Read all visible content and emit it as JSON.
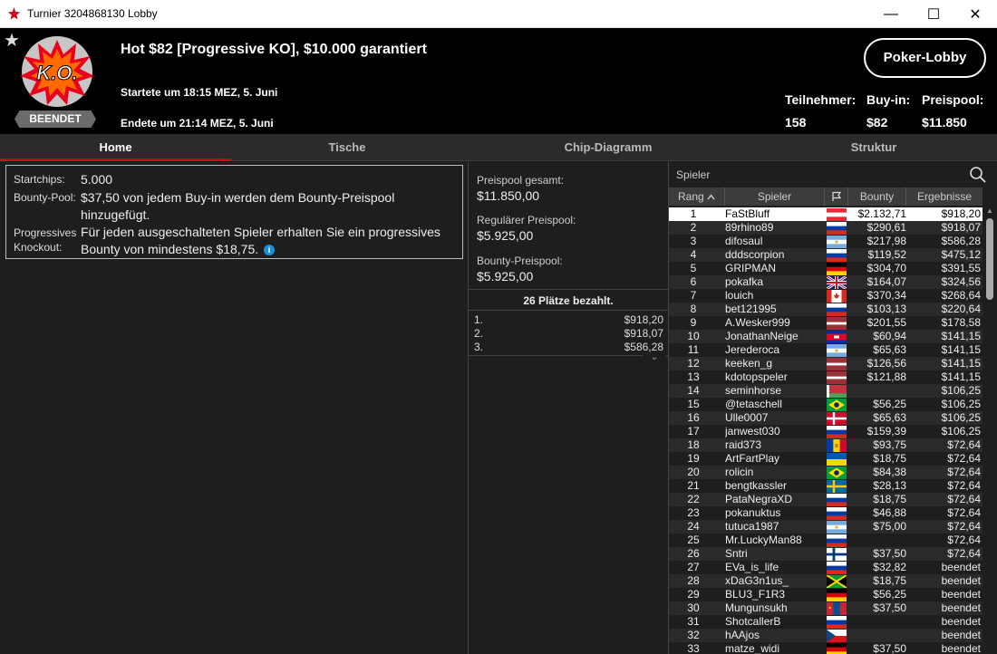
{
  "window": {
    "title": "Turnier 3204868130 Lobby",
    "minimize": "—",
    "maximize": "☐",
    "close": "✕"
  },
  "header": {
    "star": "★",
    "ko_text": "K.O.",
    "badge": "BEENDET",
    "title": "Hot $82 [Progressive KO], $10.000 garantiert",
    "started": "Startete um 18:15 MEZ, 5. Juni",
    "ended": "Endete um 21:14 MEZ, 5. Juni",
    "lobby_button": "Poker-Lobby",
    "stats": {
      "participants_label": "Teilnehmer:",
      "participants": "158",
      "buyin_label": "Buy-in:",
      "buyin": "$82",
      "prizepool_label": "Preispool:",
      "prizepool": "$11.850"
    }
  },
  "tabs": [
    "Home",
    "Tische",
    "Chip-Diagramm",
    "Struktur"
  ],
  "info": {
    "startchips_label": "Startchips:",
    "startchips": "5.000",
    "bounty_label": "Bounty-Pool:",
    "bounty_line1": "$37,50 von jedem Buy-in werden dem Bounty-Preispool",
    "bounty_line2": "hinzugefügt.",
    "pko_label1": "Progressives",
    "pko_label2": "Knockout:",
    "pko_line1": "Für jeden ausgeschalteten Spieler erhalten Sie ein progressives",
    "pko_line2": "Bounty von mindestens $18,75.",
    "info_icon": "i"
  },
  "prizes": {
    "total_label": "Preispool gesamt:",
    "total": "$11.850,00",
    "regular_label": "Regulärer Preispool:",
    "regular": "$5.925,00",
    "bounty_label": "Bounty-Preispool:",
    "bounty": "$5.925,00",
    "paid_header": "26 Plätze bezahlt.",
    "places": [
      {
        "place": "1.",
        "amount": "$918,20"
      },
      {
        "place": "2.",
        "amount": "$918,07"
      },
      {
        "place": "3.",
        "amount": "$586,28"
      }
    ],
    "more_icon": "⌄"
  },
  "players": {
    "search_label": "Spieler",
    "columns": {
      "rank": "Rang",
      "player": "Spieler",
      "bounty": "Bounty",
      "result": "Ergebnisse"
    },
    "rows": [
      {
        "rank": "1",
        "name": "FaStBluff",
        "flag": "AT",
        "bounty": "$2.132,71",
        "result": "$918,20"
      },
      {
        "rank": "2",
        "name": "89rhino89",
        "flag": "RU",
        "bounty": "$290,61",
        "result": "$918,07"
      },
      {
        "rank": "3",
        "name": "difosaul",
        "flag": "AR",
        "bounty": "$217,98",
        "result": "$586,28"
      },
      {
        "rank": "4",
        "name": "dddscorpion",
        "flag": "RU",
        "bounty": "$119,52",
        "result": "$475,12"
      },
      {
        "rank": "5",
        "name": "GRIPMAN",
        "flag": "DE",
        "bounty": "$304,70",
        "result": "$391,55"
      },
      {
        "rank": "6",
        "name": "pokafka",
        "flag": "GB",
        "bounty": "$164,07",
        "result": "$324,56"
      },
      {
        "rank": "7",
        "name": "louich",
        "flag": "CA",
        "bounty": "$370,34",
        "result": "$268,64"
      },
      {
        "rank": "8",
        "name": "bet121995",
        "flag": "RU",
        "bounty": "$103,13",
        "result": "$220,64"
      },
      {
        "rank": "9",
        "name": "A.Wesker999",
        "flag": "LV",
        "bounty": "$201,55",
        "result": "$178,58"
      },
      {
        "rank": "10",
        "name": "JonathanNeige",
        "flag": "KH",
        "bounty": "$60,94",
        "result": "$141,15"
      },
      {
        "rank": "11",
        "name": "Jerederoca",
        "flag": "AR",
        "bounty": "$65,63",
        "result": "$141,15"
      },
      {
        "rank": "12",
        "name": "keeken_g",
        "flag": "LV",
        "bounty": "$126,56",
        "result": "$141,15"
      },
      {
        "rank": "13",
        "name": "kdotopspeler",
        "flag": "LV",
        "bounty": "$121,88",
        "result": "$141,15"
      },
      {
        "rank": "14",
        "name": "seminhorse",
        "flag": "BY",
        "bounty": "",
        "result": "$106,25"
      },
      {
        "rank": "15",
        "name": "@tetaschell",
        "flag": "BR",
        "bounty": "$56,25",
        "result": "$106,25"
      },
      {
        "rank": "16",
        "name": "Ulle0007",
        "flag": "DK",
        "bounty": "$65,63",
        "result": "$106,25"
      },
      {
        "rank": "17",
        "name": "janwest030",
        "flag": "RU",
        "bounty": "$159,39",
        "result": "$106,25"
      },
      {
        "rank": "18",
        "name": "raid373",
        "flag": "MD",
        "bounty": "$93,75",
        "result": "$72,64"
      },
      {
        "rank": "19",
        "name": "ArtFartPlay",
        "flag": "UA",
        "bounty": "$18,75",
        "result": "$72,64"
      },
      {
        "rank": "20",
        "name": "rolicin",
        "flag": "BR",
        "bounty": "$84,38",
        "result": "$72,64"
      },
      {
        "rank": "21",
        "name": "bengtkassler",
        "flag": "SE",
        "bounty": "$28,13",
        "result": "$72,64"
      },
      {
        "rank": "22",
        "name": "PataNegraXD",
        "flag": "RU",
        "bounty": "$18,75",
        "result": "$72,64"
      },
      {
        "rank": "23",
        "name": "pokanuktus",
        "flag": "RU",
        "bounty": "$46,88",
        "result": "$72,64"
      },
      {
        "rank": "24",
        "name": "tutuca1987",
        "flag": "AR",
        "bounty": "$75,00",
        "result": "$72,64"
      },
      {
        "rank": "25",
        "name": "Mr.LuckyMan88",
        "flag": "RU",
        "bounty": "",
        "result": "$72,64"
      },
      {
        "rank": "26",
        "name": "Sntri",
        "flag": "FI",
        "bounty": "$37,50",
        "result": "$72,64"
      },
      {
        "rank": "27",
        "name": "EVa_is_life",
        "flag": "RU",
        "bounty": "$32,82",
        "result": "beendet"
      },
      {
        "rank": "28",
        "name": "xDaG3n1us_",
        "flag": "JM",
        "bounty": "$18,75",
        "result": "beendet"
      },
      {
        "rank": "29",
        "name": "BLU3_F1R3",
        "flag": "DE",
        "bounty": "$56,25",
        "result": "beendet"
      },
      {
        "rank": "30",
        "name": "Mungunsukh",
        "flag": "MN",
        "bounty": "$37,50",
        "result": "beendet"
      },
      {
        "rank": "31",
        "name": "ShotcallerB",
        "flag": "RU",
        "bounty": "",
        "result": "beendet"
      },
      {
        "rank": "32",
        "name": "hAAjos",
        "flag": "CZ",
        "bounty": "",
        "result": "beendet"
      },
      {
        "rank": "33",
        "name": "matze_widi",
        "flag": "DE",
        "bounty": "$37,50",
        "result": "beendet"
      }
    ]
  },
  "colors": {
    "accent": "#d0021b",
    "background": "#1e1e1e",
    "header": "#000000"
  }
}
